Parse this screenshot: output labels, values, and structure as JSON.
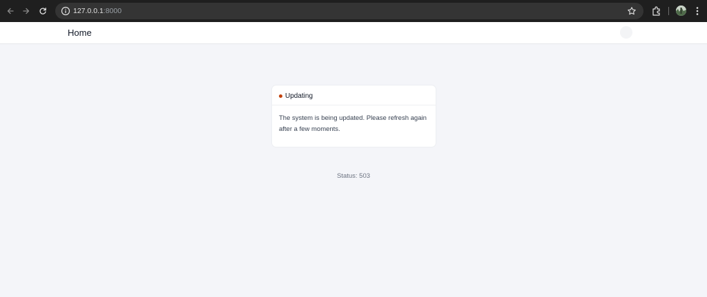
{
  "browser": {
    "url_host": "127.0.0.1",
    "url_port": ":8000"
  },
  "header": {
    "home_label": "Home"
  },
  "notice": {
    "title": "Updating",
    "message": "The system is being updated. Please refresh again after a few moments.",
    "dot_color": "#c2410c"
  },
  "status": {
    "text": "Status: 503"
  }
}
